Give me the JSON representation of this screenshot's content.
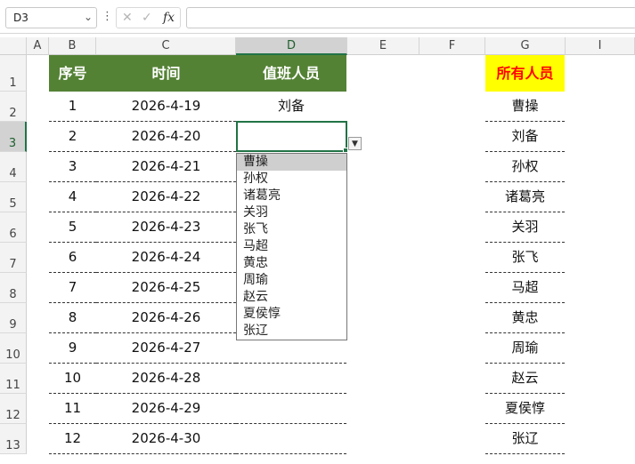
{
  "formula_bar": {
    "name_box": "D3",
    "fx_label": "fx",
    "cancel_icon": "✕",
    "confirm_icon": "✓",
    "formula": ""
  },
  "columns": [
    "A",
    "B",
    "C",
    "D",
    "E",
    "F",
    "G",
    "I"
  ],
  "rows": [
    "1",
    "2",
    "3",
    "4",
    "5",
    "6",
    "7",
    "8",
    "9",
    "10",
    "11",
    "12",
    "13"
  ],
  "table": {
    "headers": {
      "seq": "序号",
      "date": "时间",
      "duty": "值班人员",
      "all": "所有人员"
    },
    "entries": [
      {
        "seq": "1",
        "date": "2026-4-19",
        "duty": "刘备"
      },
      {
        "seq": "2",
        "date": "2026-4-20",
        "duty": ""
      },
      {
        "seq": "3",
        "date": "2026-4-21",
        "duty": ""
      },
      {
        "seq": "4",
        "date": "2026-4-22",
        "duty": ""
      },
      {
        "seq": "5",
        "date": "2026-4-23",
        "duty": ""
      },
      {
        "seq": "6",
        "date": "2026-4-24",
        "duty": ""
      },
      {
        "seq": "7",
        "date": "2026-4-25",
        "duty": ""
      },
      {
        "seq": "8",
        "date": "2026-4-26",
        "duty": ""
      },
      {
        "seq": "9",
        "date": "2026-4-27",
        "duty": ""
      },
      {
        "seq": "10",
        "date": "2026-4-28",
        "duty": ""
      },
      {
        "seq": "11",
        "date": "2026-4-29",
        "duty": ""
      },
      {
        "seq": "12",
        "date": "2026-4-30",
        "duty": ""
      }
    ],
    "all_people": [
      "曹操",
      "刘备",
      "孙权",
      "诸葛亮",
      "关羽",
      "张飞",
      "马超",
      "黄忠",
      "周瑜",
      "赵云",
      "夏侯惇",
      "张辽"
    ]
  },
  "dropdown": {
    "options": [
      "曹操",
      "孙权",
      "诸葛亮",
      "关羽",
      "张飞",
      "马超",
      "黄忠",
      "周瑜",
      "赵云",
      "夏侯惇",
      "张辽"
    ],
    "highlighted": "曹操"
  },
  "colors": {
    "header_green": "#548235",
    "highlight_yellow": "#ffff00",
    "highlight_red": "#ff0000",
    "selection_green": "#217346"
  }
}
